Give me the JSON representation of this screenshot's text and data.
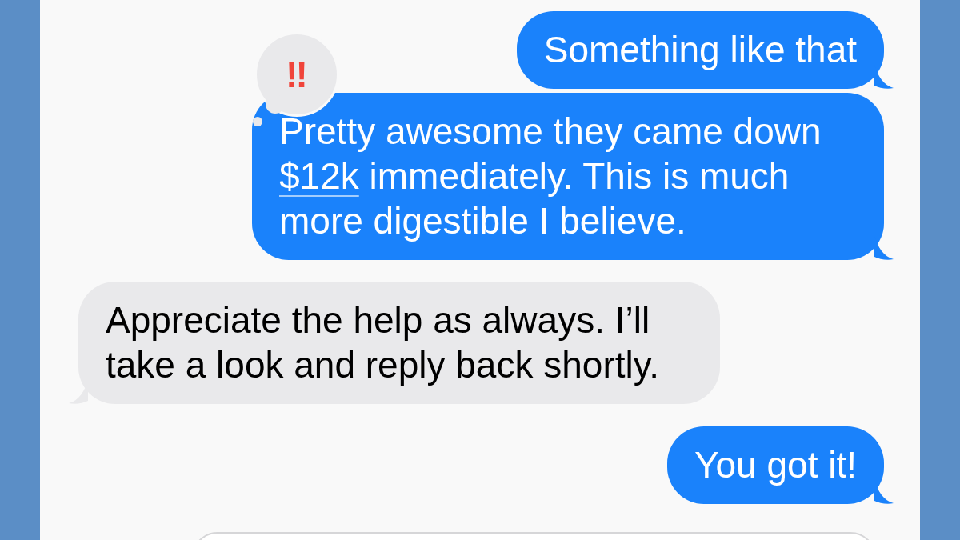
{
  "messages": [
    {
      "kind": "sent",
      "segments": [
        {
          "text": "Something like that"
        }
      ]
    },
    {
      "kind": "sent",
      "tapback": "‼",
      "segments": [
        {
          "text": "Pretty awesome they came down "
        },
        {
          "text": "$12k",
          "kind": "link"
        },
        {
          "text": " immediately. This is much more digestible I believe."
        }
      ]
    },
    {
      "kind": "received",
      "segments": [
        {
          "text": "Appreciate the help as always. I’ll take a look and reply back shortly."
        }
      ]
    },
    {
      "kind": "sent",
      "segments": [
        {
          "text": "You got it!"
        }
      ]
    }
  ]
}
